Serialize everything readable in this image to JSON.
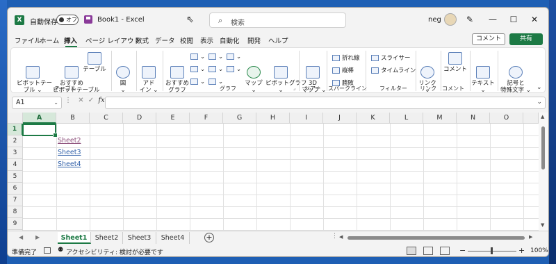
{
  "titlebar": {
    "autosave_label": "自動保存",
    "autosave_state": "オフ",
    "doc_title": "Book1  -  Excel",
    "search_placeholder": "検索",
    "user_name": "neg"
  },
  "menu": {
    "tabs": [
      "ファイル",
      "ホーム",
      "挿入",
      "ページ レイアウト",
      "数式",
      "データ",
      "校閲",
      "表示",
      "自動化",
      "開発",
      "ヘルプ"
    ],
    "active_tab": "挿入",
    "comment_button": "コメント",
    "share_button": "共有"
  },
  "ribbon": {
    "pivot_table": "ピボットテー\nブル ⌄",
    "recommended_pivot": "おすすめ\nピボットテーブル",
    "table": "テーブル",
    "illustrations": "図\n⌄",
    "addins": "アド\nイン ⌄",
    "recommended_charts": "おすすめ\nグラフ",
    "maps": "マップ\n⌄",
    "pivot_chart": "ピボットグラフ\n⌄",
    "map3d": "3D\nマップ ⌄",
    "sparkline_line": "折れ線",
    "sparkline_column": "縦棒",
    "sparkline_winloss": "勝敗",
    "slicer": "スライサー",
    "timeline": "タイムライン",
    "link": "リンク\n⌄",
    "comment": "コメント",
    "text": "テキスト\n⌄",
    "symbols": "記号と\n特殊文字 ⌄",
    "groups": {
      "table": "テーブル",
      "chart": "グラフ",
      "tour": "ツアー",
      "sparkline": "スパークライン",
      "filter": "フィルター",
      "link": "リンク",
      "comment": "コメント"
    }
  },
  "formula_bar": {
    "name_box": "A1",
    "fx": "fx",
    "value": ""
  },
  "grid": {
    "columns": [
      "A",
      "B",
      "C",
      "D",
      "E",
      "F",
      "G",
      "H",
      "I",
      "J",
      "K",
      "L",
      "M",
      "N",
      "O"
    ],
    "rows": [
      "1",
      "2",
      "3",
      "4",
      "5",
      "6",
      "7",
      "8",
      "9",
      "10"
    ],
    "active_cell": "A1",
    "links": [
      {
        "cell": "B2",
        "text": "Sheet2",
        "visited": true
      },
      {
        "cell": "B3",
        "text": "Sheet3",
        "visited": false
      },
      {
        "cell": "B4",
        "text": "Sheet4",
        "visited": false
      }
    ]
  },
  "sheet_tabs": {
    "tabs": [
      "Sheet1",
      "Sheet2",
      "Sheet3",
      "Sheet4"
    ],
    "active": "Sheet1",
    "add_label": "+"
  },
  "statusbar": {
    "ready": "準備完了",
    "accessibility": "アクセシビリティ: 検討が必要です",
    "zoom": "100%"
  },
  "colors": {
    "accent": "#1d7a45",
    "link": "#2f5fa8",
    "visited_link": "#8c4f7a",
    "desktop": "#1e5fb4"
  }
}
